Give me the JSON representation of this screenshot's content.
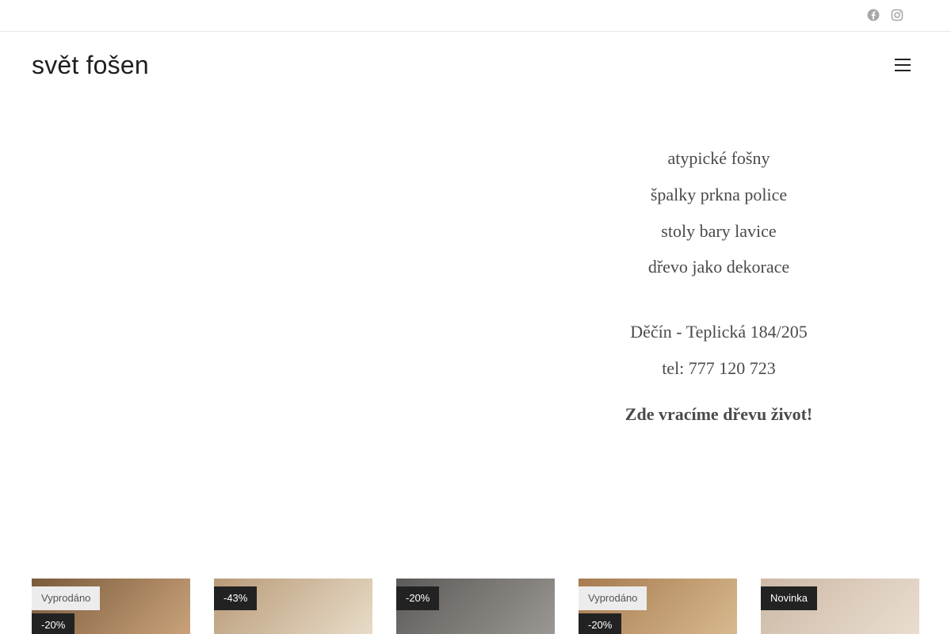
{
  "topbar": {
    "social": [
      {
        "icon": "facebook-icon"
      },
      {
        "icon": "instagram-icon"
      }
    ]
  },
  "header": {
    "logo": "svět fošen",
    "icon_glyph": "",
    "menu_icon": "hamburger-menu-icon"
  },
  "hero": {
    "lines": [
      "atypické fošny",
      "špalky prkna police",
      "stoly bary lavice",
      "dřevo jako dekorace",
      "Děčín - Teplická 184/205",
      "tel: 777 120 723",
      "Zde vracíme dřevu život!"
    ]
  },
  "products": [
    {
      "badges": [
        "Vyprodáno",
        "-20%"
      ],
      "colors": [
        "#7a5a3c",
        "#c9a27a"
      ]
    },
    {
      "badges": [
        "-43%"
      ],
      "colors": [
        "#b89a78",
        "#e8dcc8"
      ]
    },
    {
      "badges": [
        "-20%"
      ],
      "colors": [
        "#5c5a58",
        "#9b9792"
      ]
    },
    {
      "badges": [
        "Vyprodáno",
        "-20%"
      ],
      "colors": [
        "#a67b4f",
        "#d8b98f"
      ]
    },
    {
      "badges": [
        "Novinka"
      ],
      "colors": [
        "#cdb9a6",
        "#e9ddd0"
      ]
    }
  ]
}
